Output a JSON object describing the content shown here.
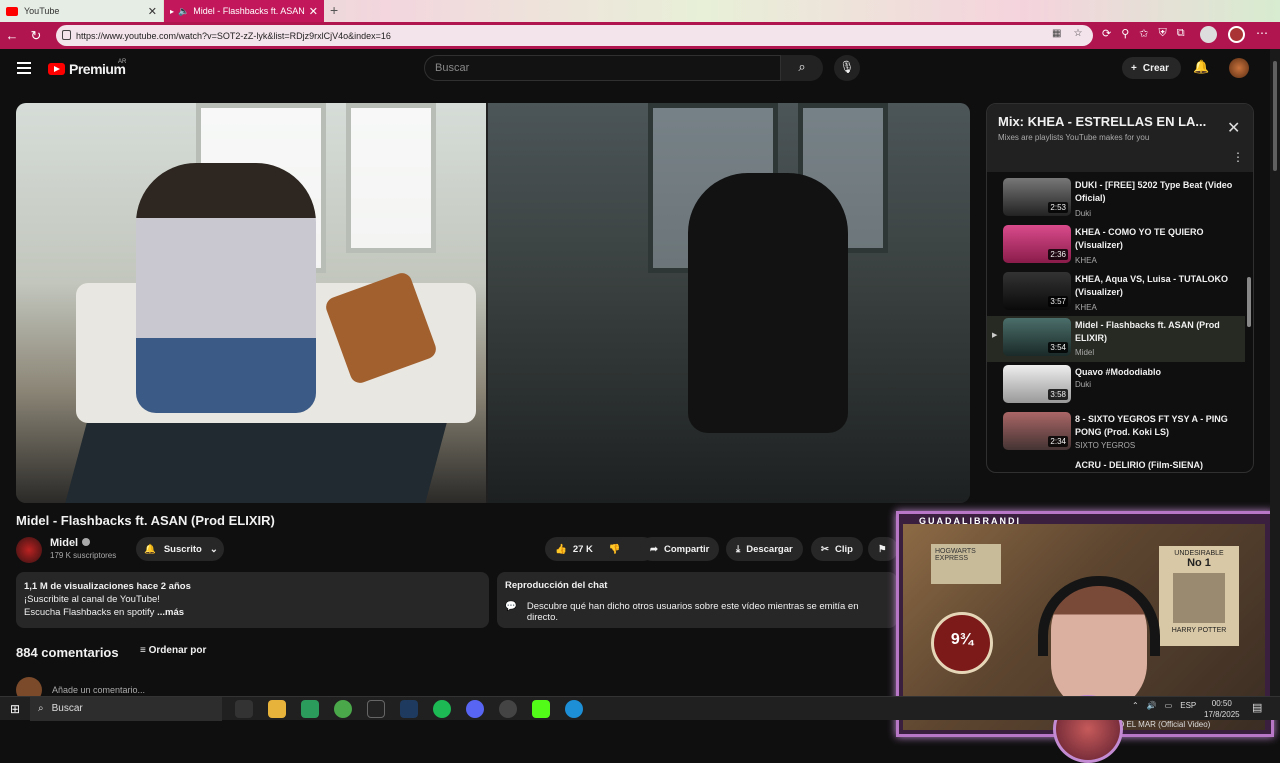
{
  "browser": {
    "tabs": [
      {
        "label": "YouTube"
      },
      {
        "label": "Midel - Flashbacks ft. ASAN"
      }
    ],
    "url": "https://www.youtube.com/watch?v=SOT2-zZ-lyk&list=RDjz9rxlCjV4o&index=16"
  },
  "header": {
    "logo_text": "Premium",
    "region": "AR",
    "search_placeholder": "Buscar",
    "create_label": "Crear"
  },
  "video": {
    "title": "Midel - Flashbacks ft. ASAN (Prod ELIXIR)",
    "channel": "Midel",
    "subscribers": "179 K suscriptores",
    "subscribed_label": "Suscrito",
    "likes": "27 K",
    "share_label": "Compartir",
    "download_label": "Descargar",
    "clip_label": "Clip"
  },
  "description": {
    "views": "1,1 M de visualizaciones",
    "age": "hace 2 años",
    "line1": "¡Suscribite al canal de YouTube!",
    "line2": "Escucha Flashbacks en spotify",
    "more": "...más"
  },
  "chat": {
    "title": "Reproducción del chat",
    "text": "Descubre qué han dicho otros usuarios sobre este vídeo mientras se emitía en directo."
  },
  "comments": {
    "count": "884 comentarios",
    "sort_label": "Ordenar por",
    "placeholder": "Añade un comentario..."
  },
  "playlist": {
    "title": "Mix: KHEA - ESTRELLAS EN LA...",
    "subtitle": "Mixes are playlists YouTube makes for you",
    "items": [
      {
        "title": "DUKI - [FREE] 5202 Type Beat (Video Oficial)",
        "channel": "Duki",
        "duration": "2:53"
      },
      {
        "title": "KHEA - COMO YO TE QUIERO (Visualizer)",
        "channel": "KHEA",
        "duration": "2:36"
      },
      {
        "title": "KHEA, Aqua VS, Luisa - TUTALOKO (Visualizer)",
        "channel": "KHEA",
        "duration": "3:57"
      },
      {
        "title": "Midel - Flashbacks ft. ASAN (Prod ELIXIR)",
        "channel": "Midel",
        "duration": "3:54"
      },
      {
        "title": "Quavo #Mododiablo",
        "channel": "Duki",
        "duration": "3:58"
      },
      {
        "title": "8 - SIXTO YEGROS FT YSY A - PING PONG (Prod. Koki LS)",
        "channel": "SIXTO YEGROS",
        "duration": "2:34"
      },
      {
        "title": "ACRU - DELIRIO (Film-SIENA)",
        "channel": "",
        "duration": ""
      }
    ]
  },
  "webcam": {
    "name": "GUADALIBRANDI",
    "poster_text": "HOGWARTS EXPRESS",
    "platform": "9¾",
    "wanted_line1": "UNDESIRABLE",
    "wanted_line2": "No 1",
    "wanted_line3": "HARRY POTTER",
    "bottom_text": "O EL MAR (Official Video)"
  },
  "taskbar": {
    "search": "Buscar",
    "lang": "ESP",
    "time": "00:50",
    "date": "17/8/2025"
  }
}
